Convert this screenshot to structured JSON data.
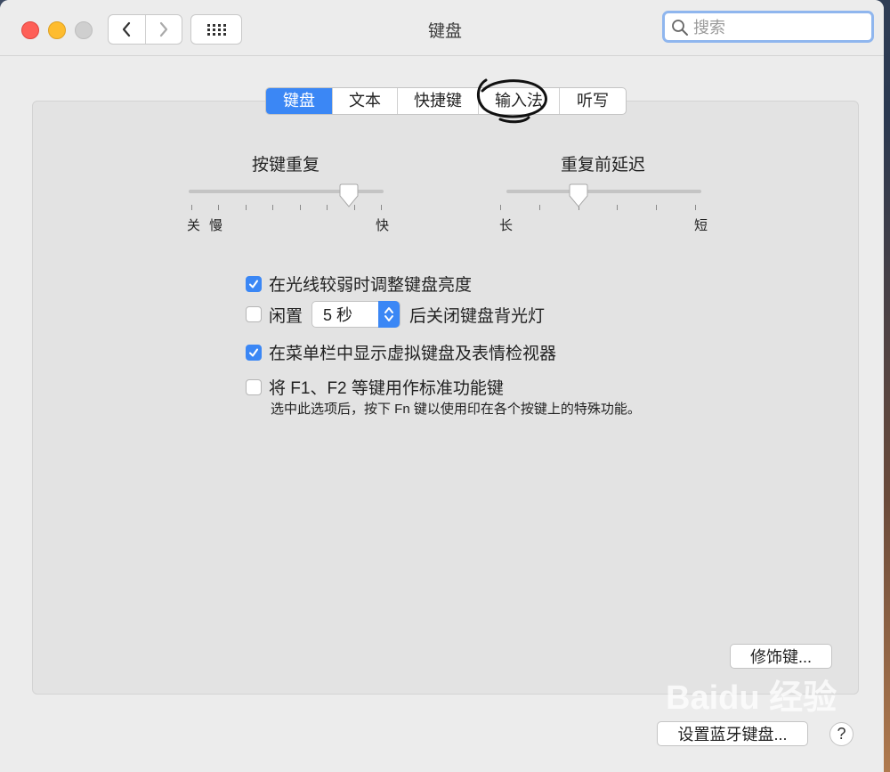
{
  "window": {
    "title": "键盘"
  },
  "search": {
    "placeholder": "搜索"
  },
  "tabs": [
    {
      "label": "键盘",
      "active": true
    },
    {
      "label": "文本",
      "active": false
    },
    {
      "label": "快捷键",
      "active": false
    },
    {
      "label": "输入法",
      "active": false
    },
    {
      "label": "听写",
      "active": false
    }
  ],
  "key_repeat": {
    "title": "按键重复",
    "label_off": "关",
    "label_slow": "慢",
    "label_fast": "快",
    "level": 0.83
  },
  "delay_until_repeat": {
    "title": "重复前延迟",
    "label_long": "长",
    "label_short": "短",
    "level": 0.4
  },
  "options": {
    "adjust_brightness": {
      "label": "在光线较弱时调整键盘亮度",
      "checked": true
    },
    "backlight_off": {
      "label_before": "闲置",
      "popup_value": "5 秒",
      "label_after": "后关闭键盘背光灯",
      "checked": false
    },
    "show_viewer": {
      "label": "在菜单栏中显示虚拟键盘及表情检视器",
      "checked": true
    },
    "fn_keys": {
      "label": "将 F1、F2 等键用作标准功能键",
      "help": "选中此选项后，按下 Fn 键以使用印在各个按键上的特殊功能。",
      "checked": false
    }
  },
  "buttons": {
    "modifier_keys": "修饰键...",
    "bluetooth_keyboard": "设置蓝牙键盘...",
    "help": "?"
  },
  "watermark": {
    "text": "Baidu 经验"
  },
  "colors": {
    "accent": "#3b87f5",
    "annotation": "#111111"
  }
}
